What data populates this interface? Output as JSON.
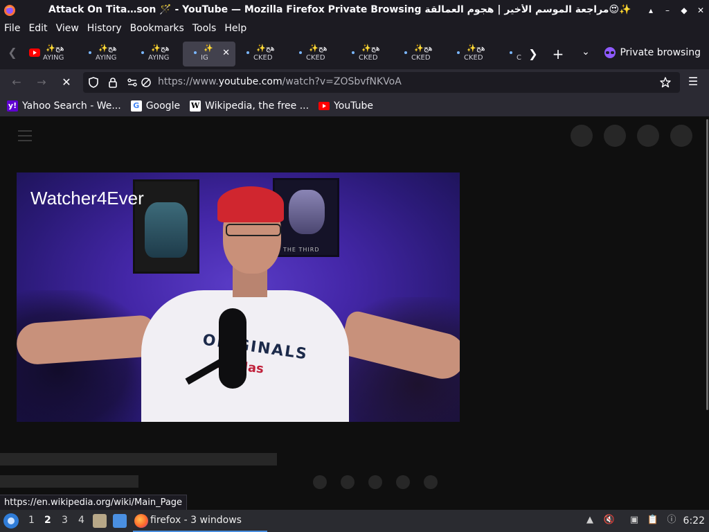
{
  "window": {
    "title": "Attack On Tita…son 🪄 - YouTube — Mozilla Firefox Private Browsing مراجعة الموسم الأخير | هجوم العمالقة😍✨",
    "buttons": [
      "▴",
      "–",
      "◆",
      "✕"
    ]
  },
  "menu": [
    "File",
    "Edit",
    "View",
    "History",
    "Bookmarks",
    "Tools",
    "Help"
  ],
  "tabs": [
    {
      "line1": "✨هج",
      "line2": "AYING",
      "favicon": "youtube-icon"
    },
    {
      "line1": "✨هج",
      "line2": "AYING",
      "favicon": "loading-dot-icon"
    },
    {
      "line1": "✨هج",
      "line2": "AYING",
      "favicon": "loading-dot-icon"
    },
    {
      "line1": "✨",
      "line2": "IG",
      "favicon": "loading-dot-icon",
      "active": true,
      "close": "✕"
    },
    {
      "line1": "✨هج",
      "line2": "CKED",
      "favicon": "loading-dot-icon"
    },
    {
      "line1": "✨هج",
      "line2": "CKED",
      "favicon": "loading-dot-icon"
    },
    {
      "line1": "✨هج",
      "line2": "CKED",
      "favicon": "loading-dot-icon"
    },
    {
      "line1": "✨هج",
      "line2": "CKED",
      "favicon": "loading-dot-icon"
    },
    {
      "line1": "✨هج",
      "line2": "CKED",
      "favicon": "loading-dot-icon"
    },
    {
      "line1": "",
      "line2": "C",
      "favicon": "loading-dot-icon"
    }
  ],
  "tabbar": {
    "private_label": "Private browsing"
  },
  "navbar": {
    "url_prefix": "https://www.",
    "url_host": "youtube.com",
    "url_path": "/watch?v=ZOSbvfNKVoA"
  },
  "bookmarks": [
    {
      "label": "Yahoo Search - We...",
      "icon": "yahoo-icon"
    },
    {
      "label": "Google",
      "icon": "google-icon"
    },
    {
      "label": "Wikipedia, the free ...",
      "icon": "wikipedia-icon"
    },
    {
      "label": "YouTube",
      "icon": "youtube-icon"
    }
  ],
  "video": {
    "channel_watermark": "Watcher4Ever",
    "poster_text": "THE THIRD",
    "shirt_text1": "ORIGINALS",
    "shirt_text2": "adidas"
  },
  "status_bar": {
    "link": "https://en.wikipedia.org/wiki/Main_Page"
  },
  "taskbar": {
    "workspaces": [
      "1",
      "2",
      "3",
      "4"
    ],
    "active_workspace": "2",
    "task_label": "firefox - 3 windows",
    "clock": "6:22"
  },
  "colors": {
    "chrome_bg": "#1c1b22",
    "toolbar_bg": "#2b2a33",
    "youtube_bg": "#0f0f0f",
    "private_purple": "#8f5aff",
    "youtube_red": "#ff0000"
  }
}
